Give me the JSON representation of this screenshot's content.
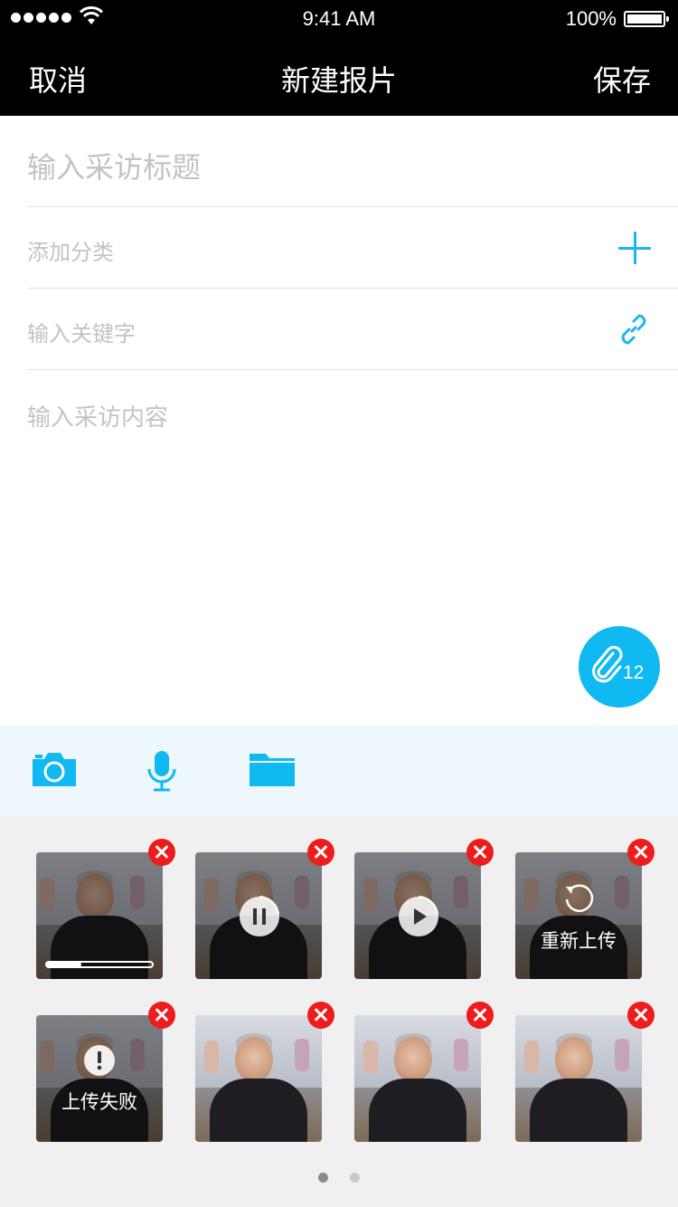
{
  "status_bar": {
    "time": "9:41 AM",
    "battery": "100%"
  },
  "nav": {
    "cancel": "取消",
    "title": "新建报片",
    "save": "保存"
  },
  "form": {
    "title_placeholder": "输入采访标题",
    "category_placeholder": "添加分类",
    "keyword_placeholder": "输入关键字",
    "content_placeholder": "输入采访内容"
  },
  "attachment_count": "12",
  "colors": {
    "accent": "#10b9f1",
    "delete": "#ee1c1c",
    "toolbar_bg": "#eef7fc"
  },
  "toolbar": {
    "icons": [
      "camera-icon",
      "microphone-icon",
      "folder-icon"
    ]
  },
  "attachments": [
    {
      "state": "uploading",
      "progress": 0.33
    },
    {
      "state": "paused",
      "caption": ""
    },
    {
      "state": "paused-play",
      "caption": ""
    },
    {
      "state": "retry",
      "caption": "重新上传"
    },
    {
      "state": "failed",
      "caption": "上传失败"
    },
    {
      "state": "done"
    },
    {
      "state": "done"
    },
    {
      "state": "done"
    }
  ],
  "pagination": {
    "pages": 2,
    "current": 1
  }
}
